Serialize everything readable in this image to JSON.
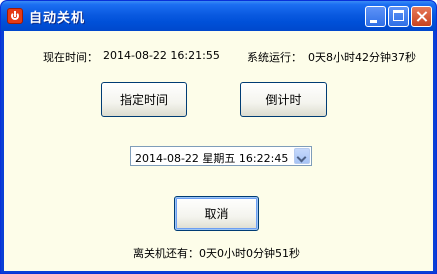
{
  "window": {
    "title": "自动关机"
  },
  "status": {
    "current_time_label": "现在时间：",
    "current_time_value": "2014-08-22  16:21:55",
    "uptime_label": "系统运行：",
    "uptime_value": "0天8小时42分钟37秒"
  },
  "buttons": {
    "specify_time": "指定时间",
    "countdown": "倒计时",
    "cancel": "取消"
  },
  "datetime_picker": {
    "value": "2014-08-22  星期五  16:22:45"
  },
  "footer": {
    "remaining_label": "离关机还有：",
    "remaining_value": "0天0小时0分钟51秒"
  }
}
